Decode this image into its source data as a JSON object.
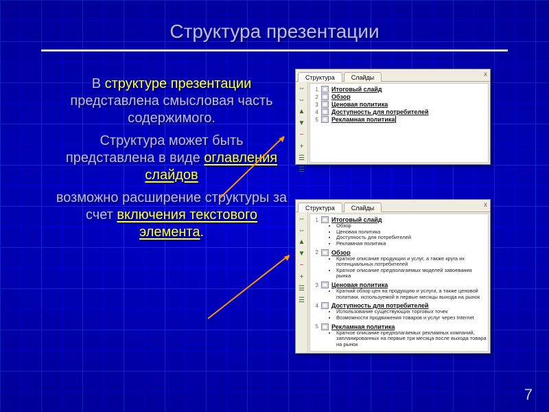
{
  "title": "Структура презентации",
  "body": {
    "p1_pre": "В ",
    "p1_hl": "структуре презентации",
    "p1_post": " представлена смысловая часть   содержимого.",
    "p2_pre": "Структура может быть представлена в виде ",
    "p2_hl": "оглавления слайдов",
    "p3_pre": "возможно расширение структуры за счет ",
    "p3_hl": "включения текстового элемента",
    "p3_post": "."
  },
  "page_number": "7",
  "panel_top": {
    "tab_active": "Структура",
    "tab_other": "Слайды",
    "close": "x",
    "tools": [
      "⇔",
      "⇔",
      "▲",
      "▼",
      "−",
      "+",
      "☰",
      "☰"
    ],
    "items": [
      {
        "n": "1",
        "t": "Итоговый слайд"
      },
      {
        "n": "2",
        "t": "Обзор"
      },
      {
        "n": "3",
        "t": "Ценовая политика"
      },
      {
        "n": "4",
        "t": "Доступность для потребителей"
      },
      {
        "n": "5",
        "t": "Рекламная политика"
      }
    ]
  },
  "panel_bot": {
    "tab_active": "Структура",
    "tab_other": "Слайды",
    "close": "x",
    "tools": [
      "⇔",
      "⇔",
      "▲",
      "▼",
      "−",
      "+",
      "☰",
      "☰"
    ],
    "sections": [
      {
        "n": "1",
        "t": "Итоговый слайд",
        "b": [
          "Обзор",
          "Ценовая политика",
          "Доступность для потребителей",
          "Рекламная политика"
        ]
      },
      {
        "n": "2",
        "t": "Обзор",
        "b": [
          "Краткое описание продукции и услуг, а также круга их потенциальных потребителей",
          "Краткое описание предполагаемых моделей завоевания рынка"
        ]
      },
      {
        "n": "3",
        "t": "Ценовая политика",
        "b": [
          "Краткий обзор цен на продукцию и услуги, а также ценовой политики, используемой в первые месяцы выхода на рынок"
        ]
      },
      {
        "n": "4",
        "t": "Доступность для потребителей",
        "b": [
          "Использование существующих торговых точек",
          "Возможности продвижения товаров и услуг через Internet"
        ]
      },
      {
        "n": "5",
        "t": "Рекламная политика",
        "b": [
          "Краткое описание предполагаемых рекламных компаний, запланированных на первые три месяца после выхода товара на рынок"
        ]
      }
    ]
  }
}
